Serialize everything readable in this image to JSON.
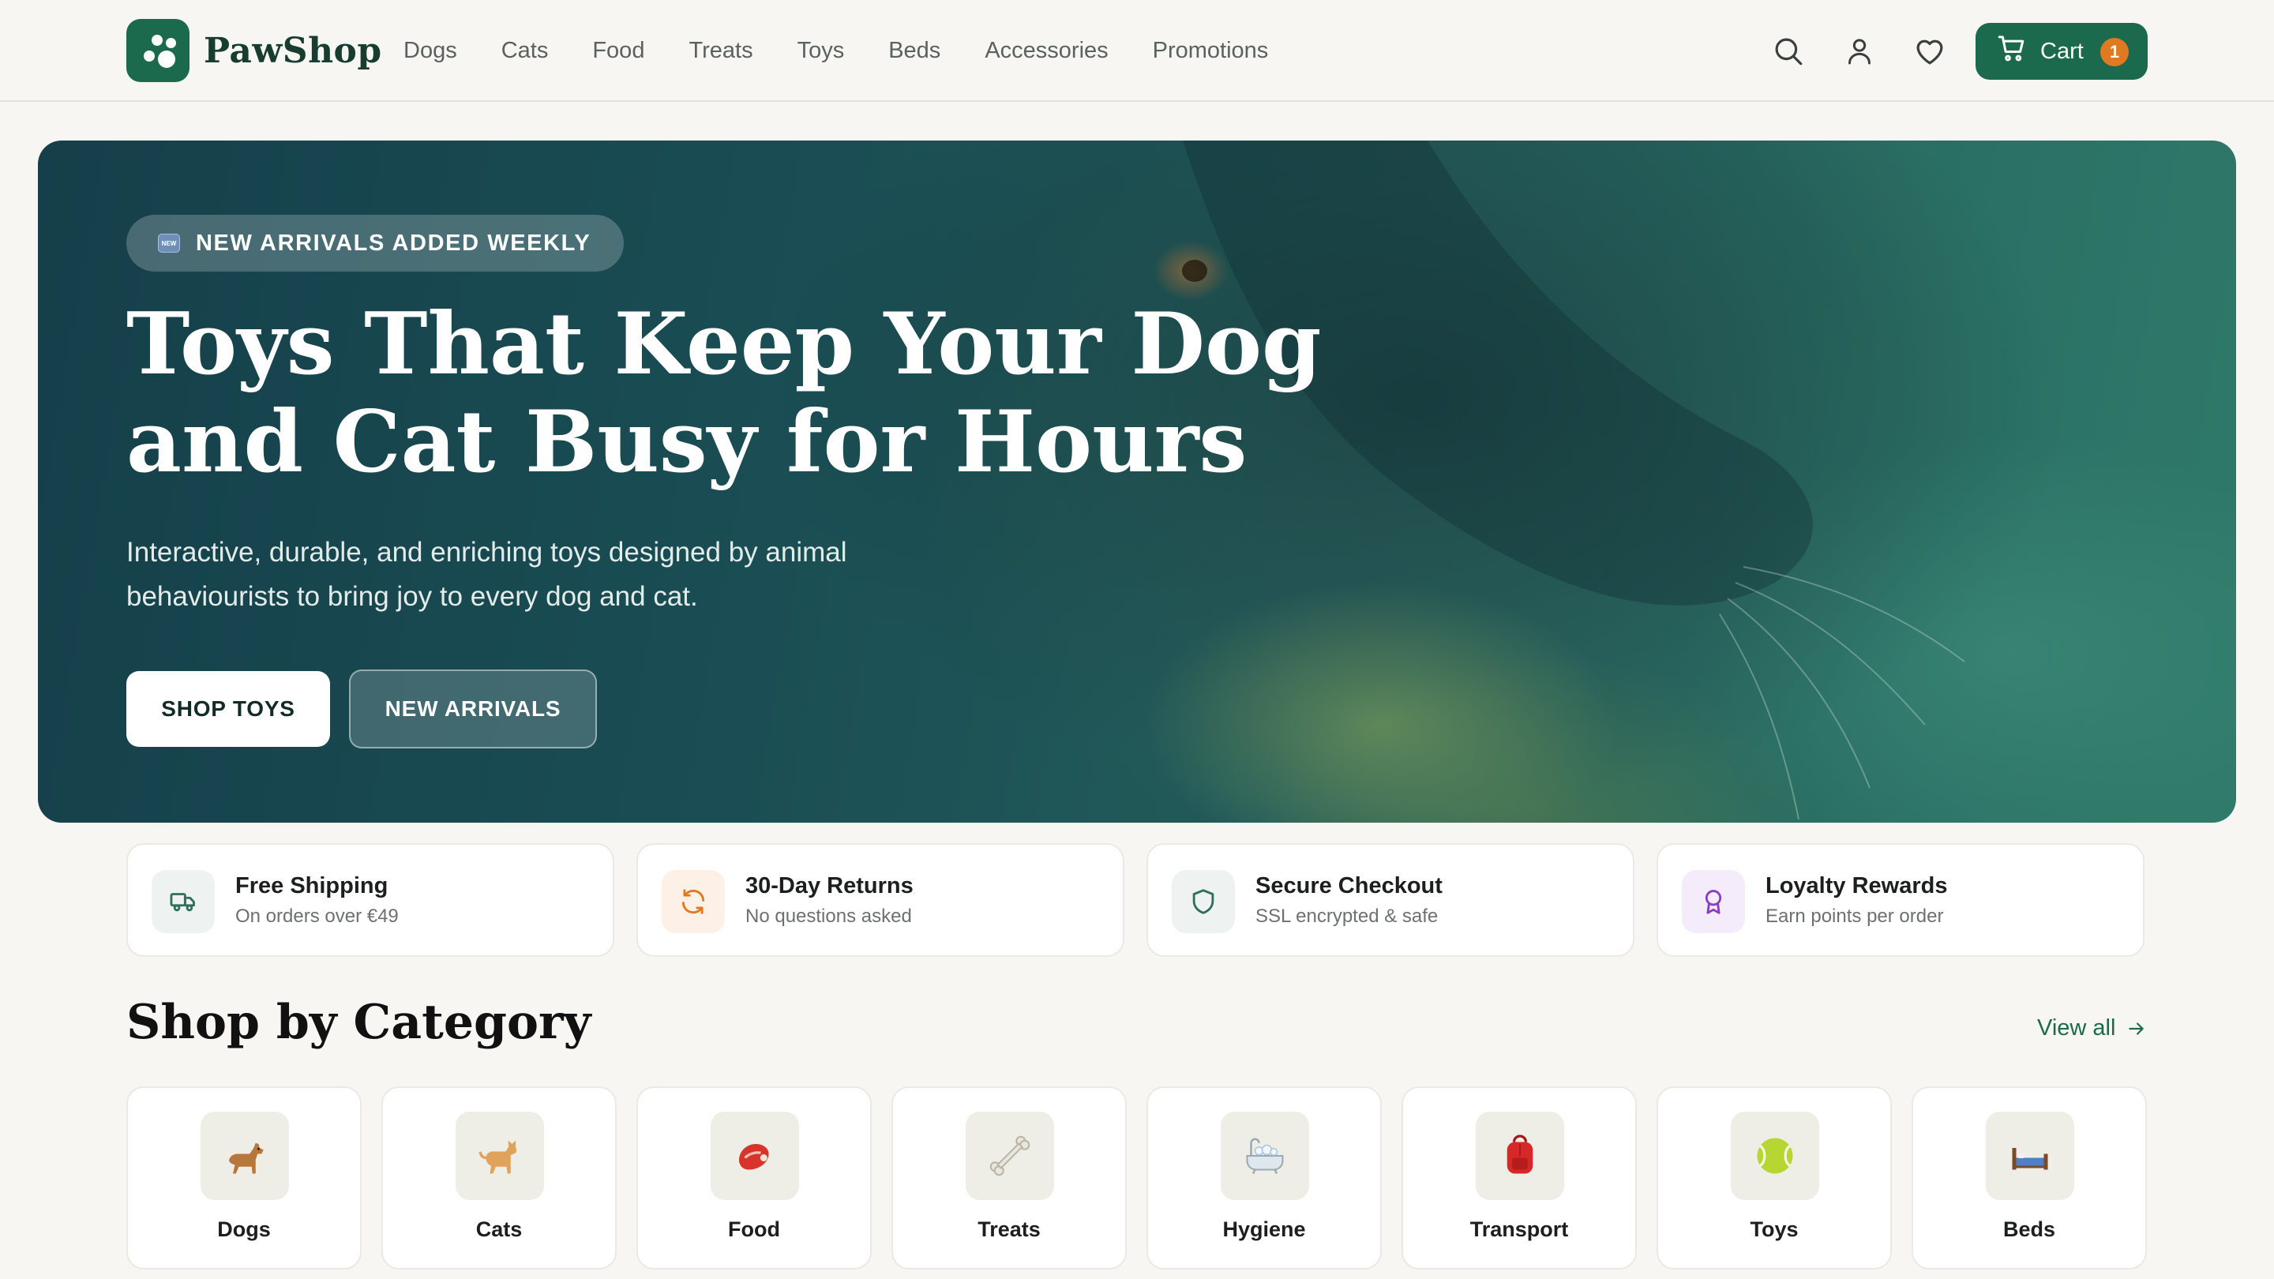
{
  "brand": {
    "name": "PawShop",
    "color": "#1b6a4d"
  },
  "nav": [
    "Dogs",
    "Cats",
    "Food",
    "Treats",
    "Toys",
    "Beds",
    "Accessories",
    "Promotions"
  ],
  "header_icons": [
    "search-icon",
    "user-icon",
    "heart-icon"
  ],
  "cart": {
    "label": "Cart",
    "count": "1"
  },
  "hero": {
    "badge_icon": "NEW",
    "badge": "NEW ARRIVALS ADDED WEEKLY",
    "title_line1": "Toys That Keep Your Dog",
    "title_line2": "and Cat Busy for Hours",
    "sub_line1": "Interactive, durable, and enriching toys designed by animal",
    "sub_line2": "behaviourists to bring joy to every dog and cat.",
    "primary_cta": "SHOP TOYS",
    "secondary_cta": "NEW ARRIVALS"
  },
  "features": [
    {
      "title": "Free Shipping",
      "subtitle": "On orders over €49",
      "icon": "truck-icon",
      "color": "#2f6f5c"
    },
    {
      "title": "30-Day Returns",
      "subtitle": "No questions asked",
      "icon": "refresh-icon",
      "color": "#e07a22"
    },
    {
      "title": "Secure Checkout",
      "subtitle": "SSL encrypted & safe",
      "icon": "shield-icon",
      "color": "#2f6f5c"
    },
    {
      "title": "Loyalty Rewards",
      "subtitle": "Earn points per order",
      "icon": "award-icon",
      "color": "#8a3fc0"
    }
  ],
  "categories": {
    "title": "Shop by Category",
    "view_all": "View all",
    "items": [
      {
        "label": "Dogs",
        "emoji": "🐕"
      },
      {
        "label": "Cats",
        "emoji": "🐈"
      },
      {
        "label": "Food",
        "emoji": "🥩"
      },
      {
        "label": "Treats",
        "emoji": "🦴"
      },
      {
        "label": "Hygiene",
        "emoji": "🛁"
      },
      {
        "label": "Transport",
        "emoji": "🎒"
      },
      {
        "label": "Toys",
        "emoji": "🎾"
      },
      {
        "label": "Beds",
        "emoji": "🛏"
      }
    ]
  }
}
